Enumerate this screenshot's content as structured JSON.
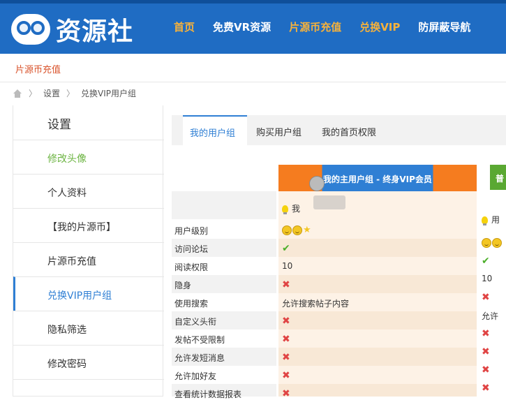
{
  "header": {
    "logo_text": "资源社",
    "nav": [
      "首页",
      "免费VR资源",
      "片源币充值",
      "兑换VIP",
      "防屏蔽导航"
    ]
  },
  "subbar": {
    "title": "片源币充值"
  },
  "breadcrumb": [
    "设置",
    "兑换VIP用户组"
  ],
  "sidebar": {
    "title": "设置",
    "items": [
      "修改头像",
      "个人资料",
      "【我的片源币】",
      "片源币充值",
      "兑换VIP用户组",
      "隐私筛选",
      "修改密码"
    ]
  },
  "tabs": [
    "我的用户组",
    "购买用户组",
    "我的首页权限"
  ],
  "row_labels": [
    "用户级别",
    "访问论坛",
    "阅读权限",
    "隐身",
    "使用搜索",
    "自定义头衔",
    "发帖不受限制",
    "允许发短消息",
    "允许加好友",
    "查看统计数据报表"
  ],
  "group1": {
    "header": "我的主用户组 - 终身VIP会员",
    "name": "我",
    "read_level": "10",
    "search": "允许搜索帖子内容"
  },
  "group2": {
    "header": "普",
    "name": "用",
    "read_level": "10",
    "search": "允许"
  }
}
